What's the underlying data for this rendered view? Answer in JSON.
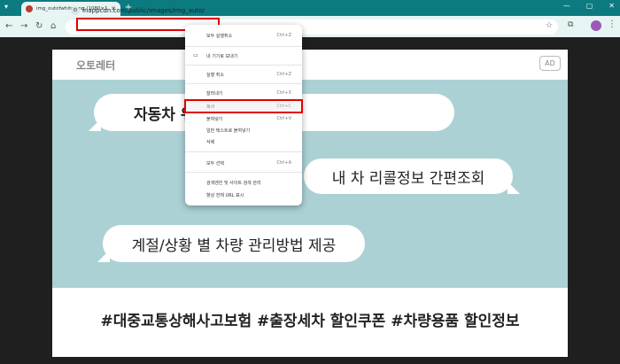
{
  "browser": {
    "tab_title": "img_outofwhite.png (1080×108)",
    "url": "inappcdn.com/public/images/img_auto/",
    "window_controls": [
      "—",
      "▢",
      "✕"
    ]
  },
  "page": {
    "brand": "오토레터",
    "ad_badge": "AD",
    "bubble1": "자동차                        위한 스페셜 혜택!",
    "bubble2": "내 차 리콜정보 간편조회",
    "bubble3": "계절/상황 별 차량 관리방법 제공",
    "hashtags": "#대중교통상해사고보험  #출장세차 할인쿠폰  #차량용품 할인정보"
  },
  "context_menu": {
    "items": [
      {
        "label": "모두 실행취소",
        "shortcut": "Ctrl+Z"
      },
      {
        "label": "내 기기로 보내기",
        "shortcut": ""
      },
      {
        "label": "실행 취소",
        "shortcut": "Ctrl+Z"
      },
      {
        "label": "잘라내기",
        "shortcut": "Ctrl+X"
      },
      {
        "label": "복사",
        "shortcut": "Ctrl+C"
      },
      {
        "label": "붙여넣기",
        "shortcut": "Ctrl+V"
      },
      {
        "label": "일반 텍스트로 붙여넣기",
        "shortcut": ""
      },
      {
        "label": "삭제",
        "shortcut": ""
      },
      {
        "label": "모두 선택",
        "shortcut": "Ctrl+A"
      },
      {
        "label": "검색엔진 및 사이트 검색 관리",
        "shortcut": ""
      },
      {
        "label": "항상 전체 URL 표시",
        "shortcut": ""
      }
    ]
  },
  "colors": {
    "tabstrip": "#0c7b80",
    "toolbar": "#e6f4f4",
    "teal_area": "#acd1d5",
    "highlight": "#e10000"
  }
}
